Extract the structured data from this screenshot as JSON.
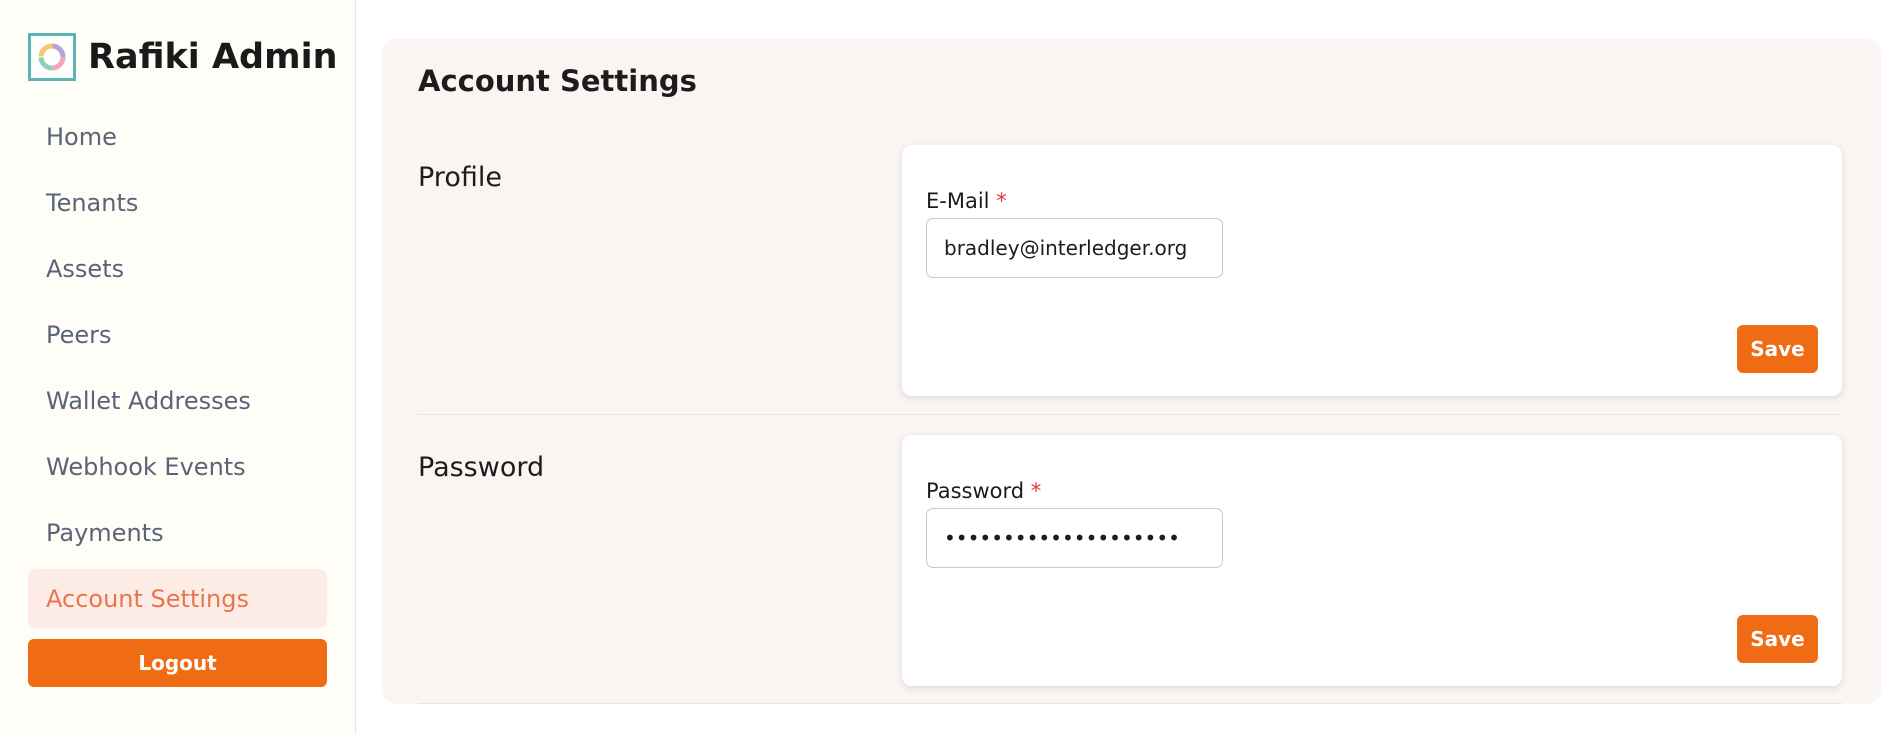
{
  "app": {
    "title": "Rafiki Admin",
    "logo_icon": "rafiki-ring-logo-icon"
  },
  "sidebar": {
    "items": [
      {
        "label": "Home",
        "active": false
      },
      {
        "label": "Tenants",
        "active": false
      },
      {
        "label": "Assets",
        "active": false
      },
      {
        "label": "Peers",
        "active": false
      },
      {
        "label": "Wallet Addresses",
        "active": false
      },
      {
        "label": "Webhook Events",
        "active": false
      },
      {
        "label": "Payments",
        "active": false
      },
      {
        "label": "Account Settings",
        "active": true
      }
    ],
    "logout_label": "Logout"
  },
  "main": {
    "page_title": "Account Settings",
    "profile": {
      "section_title": "Profile",
      "field_label": "E-Mail",
      "required_mark": "*",
      "value": "bradley@interledger.org",
      "save_label": "Save"
    },
    "password": {
      "section_title": "Password",
      "field_label": "Password",
      "required_mark": "*",
      "value": "••••••••••••••••••••",
      "save_label": "Save"
    }
  },
  "colors": {
    "accent": "#ef6c15",
    "active_nav_bg": "#fdece6",
    "active_nav_text": "#e8754e",
    "nav_text": "#5a6476",
    "panel_bg": "#faf5f2",
    "required": "#e03a3a"
  }
}
